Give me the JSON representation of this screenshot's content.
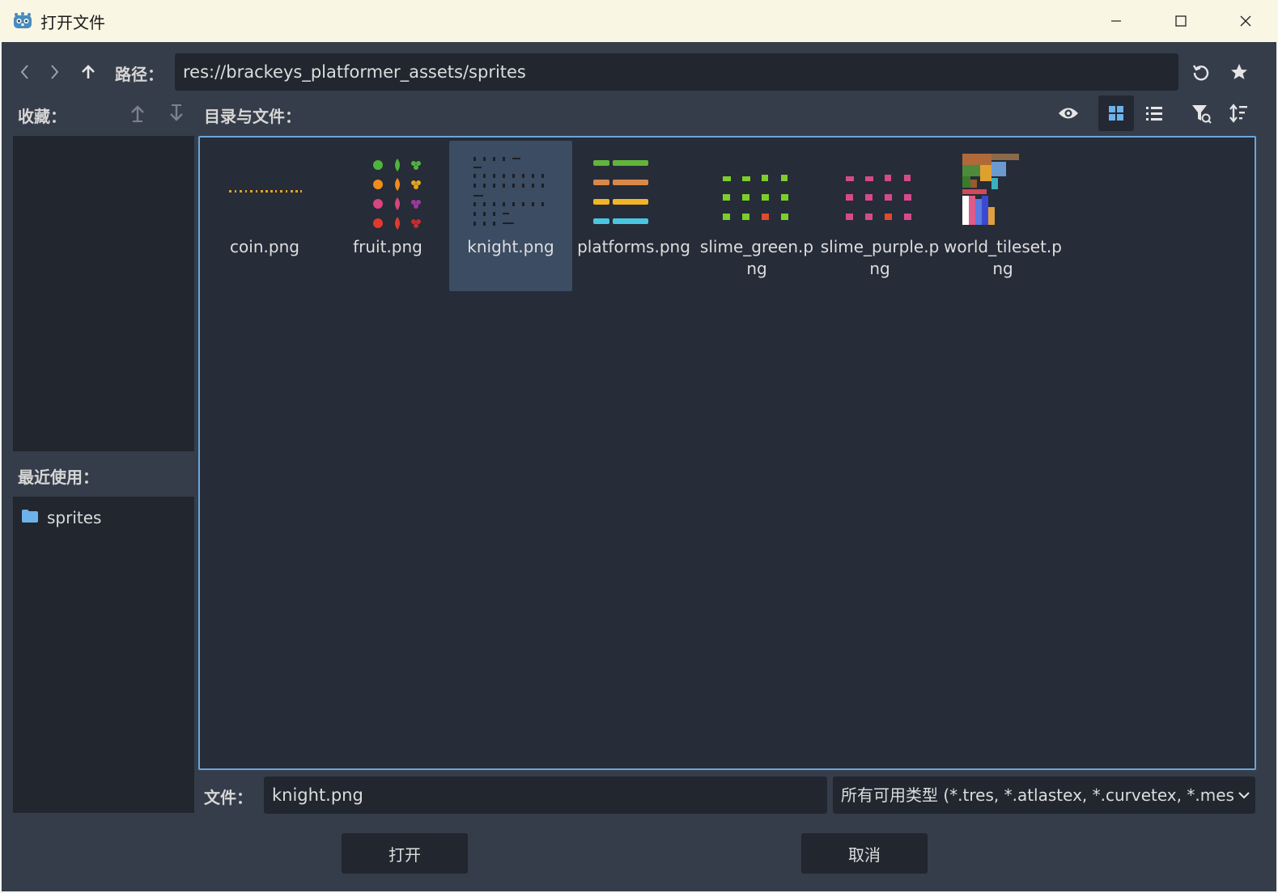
{
  "window": {
    "title": "打开文件",
    "app_icon": "godot-icon",
    "controls": [
      "minimize-icon",
      "maximize-icon",
      "close-icon"
    ]
  },
  "path_bar": {
    "label": "路径：",
    "value": "res://brackeys_platformer_assets/sprites",
    "nav_icons": [
      "back-arrow-icon",
      "forward-arrow-icon",
      "up-arrow-icon"
    ],
    "action_icons": [
      "refresh-icon",
      "favorite-star-icon"
    ]
  },
  "favorites": {
    "label": "收藏：",
    "move_icons": [
      "move-up-icon",
      "move-down-icon"
    ]
  },
  "directory": {
    "label": "目录与文件：",
    "toolbar_icons": [
      "show-hidden-eye-icon",
      "grid-view-icon",
      "list-view-icon",
      "filter-icon",
      "sort-icon"
    ],
    "active_view": "grid"
  },
  "recent": {
    "label": "最近使用：",
    "items": [
      {
        "name": "sprites",
        "icon": "folder-icon"
      }
    ]
  },
  "files": [
    {
      "name": "coin.png",
      "selected": false
    },
    {
      "name": "fruit.png",
      "selected": false
    },
    {
      "name": "knight.png",
      "selected": true
    },
    {
      "name": "platforms.png",
      "selected": false
    },
    {
      "name": "slime_green.png",
      "selected": false
    },
    {
      "name": "slime_purple.png",
      "selected": false
    },
    {
      "name": "world_tileset.png",
      "selected": false
    }
  ],
  "file_field": {
    "label": "文件：",
    "value": "knight.png"
  },
  "filter": {
    "value": "所有可用类型 (*.tres, *.atlastex, *.curvetex, *.mes",
    "icon": "chevron-down-icon"
  },
  "buttons": {
    "open": "打开",
    "cancel": "取消"
  },
  "colors": {
    "panel": "#363d4a",
    "field": "#21262f",
    "grid_bg": "#262c38",
    "focus_border": "#69a6da",
    "selection": "#3b4c63"
  }
}
